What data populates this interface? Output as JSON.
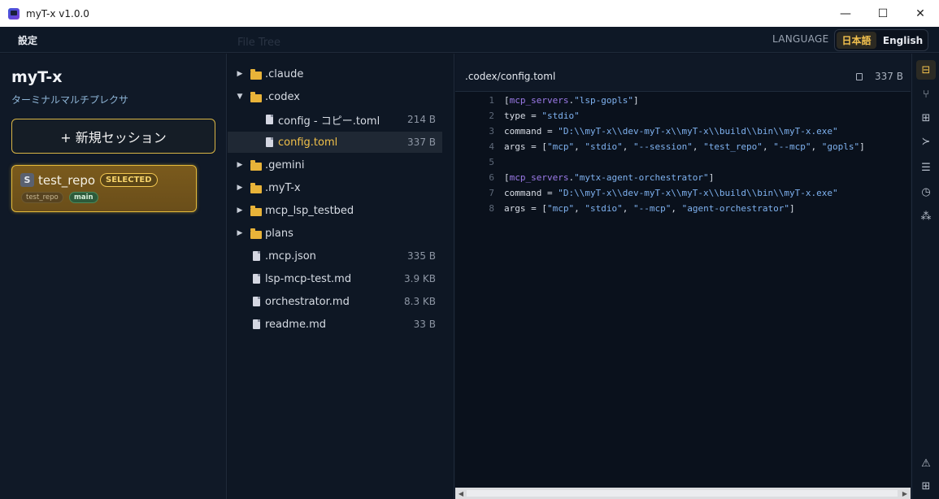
{
  "window": {
    "title": "myT-x v1.0.0",
    "controls": {
      "minimize": "—",
      "maximize": "☐",
      "close": "✕"
    }
  },
  "menubar": {
    "settings_label": "設定",
    "faint_title": "File Tree",
    "language_label": "LANGUAGE",
    "language_options": [
      "日本語",
      "English"
    ],
    "language_selected": "日本語"
  },
  "sidebar": {
    "app_name": "myT-x",
    "app_subtitle": "ターミナルマルチプレクサ",
    "new_session_label": "+ 新規セッション",
    "sessions": [
      {
        "badge": "S",
        "name": "test_repo",
        "status": "SELECTED",
        "repo_tag": "test_repo",
        "branch_tag": "main"
      }
    ]
  },
  "file_tree": {
    "items": [
      {
        "type": "folder",
        "name": ".claude",
        "expanded": false,
        "depth": 0
      },
      {
        "type": "folder",
        "name": ".codex",
        "expanded": true,
        "depth": 0
      },
      {
        "type": "file",
        "name": "config - コピー.toml",
        "size": "214 B",
        "depth": 1
      },
      {
        "type": "file",
        "name": "config.toml",
        "size": "337 B",
        "depth": 1,
        "active": true
      },
      {
        "type": "folder",
        "name": ".gemini",
        "expanded": false,
        "depth": 0
      },
      {
        "type": "folder",
        "name": ".myT-x",
        "expanded": false,
        "depth": 0
      },
      {
        "type": "folder",
        "name": "mcp_lsp_testbed",
        "expanded": false,
        "depth": 0
      },
      {
        "type": "folder",
        "name": "plans",
        "expanded": false,
        "depth": 0
      },
      {
        "type": "file",
        "name": ".mcp.json",
        "size": "335 B",
        "depth": 0
      },
      {
        "type": "file",
        "name": "lsp-mcp-test.md",
        "size": "3.9 KB",
        "depth": 0
      },
      {
        "type": "file",
        "name": "orchestrator.md",
        "size": "8.3 KB",
        "depth": 0
      },
      {
        "type": "file",
        "name": "readme.md",
        "size": "33 B",
        "depth": 0
      }
    ]
  },
  "editor": {
    "path": ".codex/config.toml",
    "size": "337 B",
    "lines": [
      {
        "n": "1",
        "tokens": [
          [
            "pl",
            "["
          ],
          [
            "key",
            "mcp_servers"
          ],
          [
            "pl",
            "."
          ],
          [
            "str",
            "\"lsp-gopls\""
          ],
          [
            "pl",
            "]"
          ]
        ]
      },
      {
        "n": "2",
        "tokens": [
          [
            "pl",
            "type = "
          ],
          [
            "str",
            "\"stdio\""
          ]
        ]
      },
      {
        "n": "3",
        "tokens": [
          [
            "pl",
            "command = "
          ],
          [
            "str",
            "\"D:\\\\myT-x\\\\dev-myT-x\\\\myT-x\\\\build\\\\bin\\\\myT-x.exe\""
          ]
        ]
      },
      {
        "n": "4",
        "tokens": [
          [
            "pl",
            "args = ["
          ],
          [
            "str",
            "\"mcp\""
          ],
          [
            "pl",
            ", "
          ],
          [
            "str",
            "\"stdio\""
          ],
          [
            "pl",
            ", "
          ],
          [
            "str",
            "\"--session\""
          ],
          [
            "pl",
            ", "
          ],
          [
            "str",
            "\"test_repo\""
          ],
          [
            "pl",
            ", "
          ],
          [
            "str",
            "\"--mcp\""
          ],
          [
            "pl",
            ", "
          ],
          [
            "str",
            "\"gopls\""
          ],
          [
            "pl",
            "]"
          ]
        ]
      },
      {
        "n": "5",
        "tokens": []
      },
      {
        "n": "6",
        "tokens": [
          [
            "pl",
            "["
          ],
          [
            "key",
            "mcp_servers"
          ],
          [
            "pl",
            "."
          ],
          [
            "str",
            "\"mytx-agent-orchestrator\""
          ],
          [
            "pl",
            "]"
          ]
        ]
      },
      {
        "n": "7",
        "tokens": [
          [
            "pl",
            "command = "
          ],
          [
            "str",
            "\"D:\\\\myT-x\\\\dev-myT-x\\\\myT-x\\\\build\\\\bin\\\\myT-x.exe\""
          ]
        ]
      },
      {
        "n": "8",
        "tokens": [
          [
            "pl",
            "args = ["
          ],
          [
            "str",
            "\"mcp\""
          ],
          [
            "pl",
            ", "
          ],
          [
            "str",
            "\"stdio\""
          ],
          [
            "pl",
            ", "
          ],
          [
            "str",
            "\"--mcp\""
          ],
          [
            "pl",
            ", "
          ],
          [
            "str",
            "\"agent-orchestrator\""
          ],
          [
            "pl",
            "]"
          ]
        ]
      }
    ]
  },
  "rail": {
    "icons": [
      {
        "name": "file-tree-icon",
        "glyph": "⊟",
        "active": true
      },
      {
        "name": "git-branch-icon",
        "glyph": "⑂"
      },
      {
        "name": "diff-icon",
        "glyph": "⊞"
      },
      {
        "name": "terminal-icon",
        "glyph": "≻"
      },
      {
        "name": "layout-icon",
        "glyph": "☰"
      },
      {
        "name": "history-icon",
        "glyph": "◷"
      },
      {
        "name": "agents-icon",
        "glyph": "⁂"
      },
      {
        "name": "warning-icon",
        "glyph": "⚠"
      },
      {
        "name": "grid-icon",
        "glyph": "⊞"
      }
    ]
  },
  "colors": {
    "accent": "#f2c14e",
    "background": "#0d1522",
    "toml_key": "#9d7bea",
    "toml_string": "#7fb2f0",
    "branch_tag": "#2d5a3a"
  }
}
